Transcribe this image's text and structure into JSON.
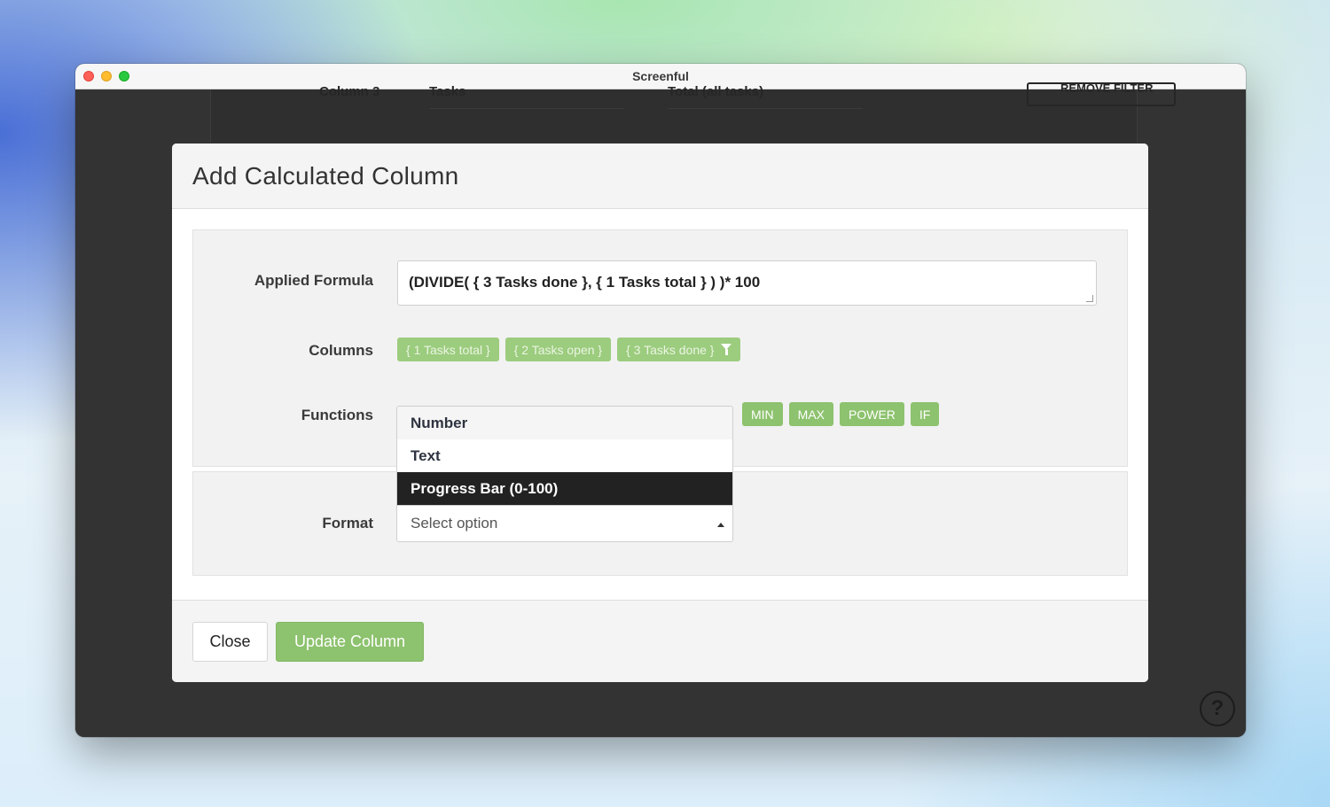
{
  "window": {
    "title": "Screenful"
  },
  "background": {
    "column_label": "Column 3",
    "source_value": "Tasks",
    "metric_value": "Total (all tasks)",
    "remove_filter": "REMOVE FILTER",
    "help_glyph": "?"
  },
  "modal": {
    "title": "Add Calculated Column",
    "formula": {
      "label": "Applied Formula",
      "value": "(DIVIDE( { 3 Tasks done },  { 1 Tasks total }  ) )* 100"
    },
    "columns": {
      "label": "Columns",
      "items": [
        "{ 1 Tasks total }",
        "{ 2 Tasks open }",
        "{ 3 Tasks done }"
      ]
    },
    "functions": {
      "label": "Functions",
      "visible_items": [
        "MIN",
        "MAX",
        "POWER",
        "IF"
      ]
    },
    "format": {
      "label": "Format",
      "placeholder": "Select option",
      "options": [
        "Number",
        "Text",
        "Progress Bar (0-100)"
      ],
      "highlighted": "Progress Bar (0-100)"
    },
    "footer": {
      "close_label": "Close",
      "update_label": "Update Column"
    }
  },
  "colors": {
    "accent_green": "#8dc26e",
    "chip_green": "#9ccc7e",
    "dropdown_highlight": "#222222",
    "window_dark": "#333333"
  },
  "icons": [
    "filter-icon",
    "caret-up-icon",
    "help-icon"
  ]
}
